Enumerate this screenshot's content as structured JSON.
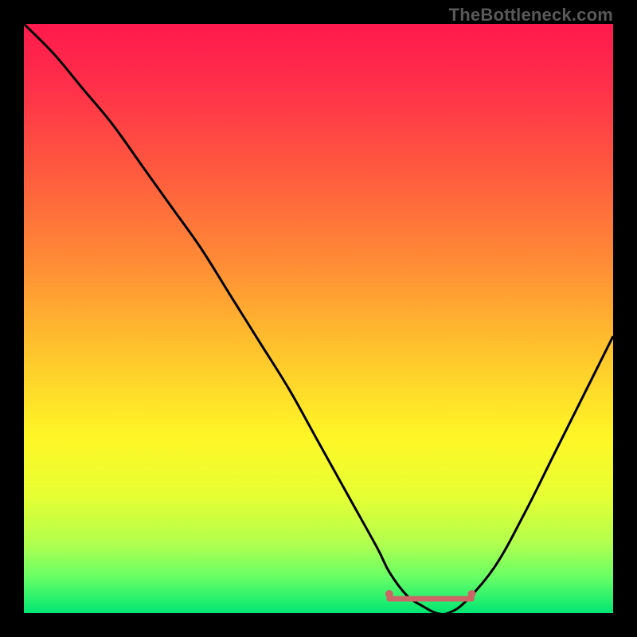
{
  "watermark": "TheBottleneck.com",
  "chart_data": {
    "type": "line",
    "title": "",
    "xlabel": "",
    "ylabel": "",
    "xlim": [
      0,
      100
    ],
    "ylim": [
      0,
      100
    ],
    "grid": false,
    "legend": false,
    "series": [
      {
        "name": "bottleneck-curve",
        "x": [
          0,
          5,
          10,
          15,
          20,
          25,
          30,
          35,
          40,
          45,
          50,
          55,
          60,
          62,
          65,
          68,
          70,
          72,
          75,
          80,
          85,
          90,
          95,
          100
        ],
        "y": [
          100,
          95,
          89,
          83,
          76,
          69,
          62,
          54,
          46,
          38,
          29,
          20,
          11,
          7,
          3,
          1,
          0,
          0,
          2,
          8,
          17,
          27,
          37,
          47
        ]
      }
    ],
    "markers": [
      {
        "name": "range-start",
        "x": 62,
        "y": 4,
        "color": "#cc6666"
      },
      {
        "name": "range-end",
        "x": 76,
        "y": 4,
        "color": "#cc6666"
      }
    ],
    "highlight_band": {
      "x_start": 62,
      "x_end": 76,
      "color": "#cc6666"
    },
    "gradient_stops": [
      {
        "offset": 0.0,
        "color": "#ff1a4d"
      },
      {
        "offset": 0.1,
        "color": "#ff2e4a"
      },
      {
        "offset": 0.25,
        "color": "#ff5a3f"
      },
      {
        "offset": 0.4,
        "color": "#ff8a36"
      },
      {
        "offset": 0.55,
        "color": "#ffc22d"
      },
      {
        "offset": 0.7,
        "color": "#fff626"
      },
      {
        "offset": 0.8,
        "color": "#e6ff33"
      },
      {
        "offset": 0.88,
        "color": "#b3ff4d"
      },
      {
        "offset": 0.94,
        "color": "#66ff66"
      },
      {
        "offset": 1.0,
        "color": "#00e673"
      }
    ]
  }
}
